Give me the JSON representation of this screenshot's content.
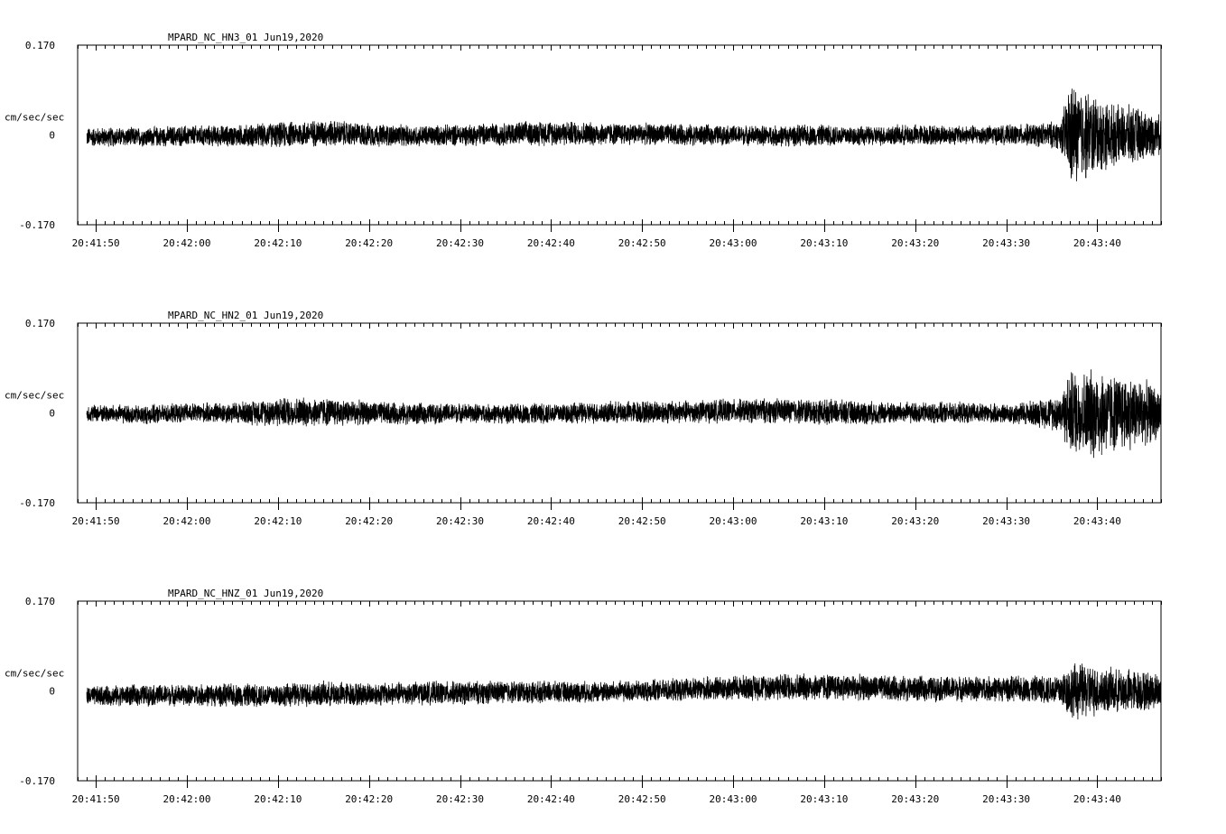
{
  "chart_data": [
    {
      "type": "line",
      "title": "MPARD_NC_HN3_01  Jun19,2020",
      "ylabel": "cm/sec/sec",
      "ylim": [
        -0.17,
        0.17
      ],
      "ytick_labels": [
        "0.170",
        "0",
        "-0.170"
      ],
      "x_start_time": "20:41:48",
      "x_end_time": "20:43:47",
      "xtick_labels": [
        "20:41:50",
        "20:42:00",
        "20:42:10",
        "20:42:20",
        "20:42:30",
        "20:42:40",
        "20:42:50",
        "20:43:00",
        "20:43:10",
        "20:43:20",
        "20:43:30",
        "20:43:40"
      ],
      "series": [
        {
          "x": [
            "20:41:49",
            "20:41:55",
            "20:42:00",
            "20:42:05",
            "20:42:10",
            "20:42:15",
            "20:42:20",
            "20:42:25",
            "20:42:30",
            "20:42:35",
            "20:42:40",
            "20:42:45",
            "20:42:50",
            "20:42:55",
            "20:43:00",
            "20:43:05",
            "20:43:10",
            "20:43:15",
            "20:43:20",
            "20:43:25",
            "20:43:30",
            "20:43:34",
            "20:43:36",
            "20:43:37",
            "20:43:38",
            "20:43:39",
            "20:43:40",
            "20:43:42",
            "20:43:44",
            "20:43:46",
            "20:43:47"
          ],
          "envelope": [
            0.02,
            0.02,
            0.022,
            0.022,
            0.026,
            0.028,
            0.024,
            0.022,
            0.022,
            0.024,
            0.026,
            0.024,
            0.022,
            0.022,
            0.02,
            0.022,
            0.022,
            0.02,
            0.022,
            0.02,
            0.02,
            0.025,
            0.03,
            0.11,
            0.1,
            0.09,
            0.08,
            0.06,
            0.06,
            0.045,
            0.04
          ],
          "offset": [
            -0.004,
            -0.004,
            -0.002,
            -0.002,
            0.0,
            0.004,
            0.0,
            -0.002,
            0.0,
            0.002,
            0.004,
            0.002,
            0.002,
            0.0,
            0.0,
            -0.002,
            0.0,
            -0.002,
            0.0,
            0.0,
            0.0,
            0.0,
            0.0,
            0.0,
            0.0,
            0.0,
            0.0,
            0.0,
            0.0,
            0.0,
            0.0
          ]
        }
      ]
    },
    {
      "type": "line",
      "title": "MPARD_NC_HN2_01  Jun19,2020",
      "ylabel": "cm/sec/sec",
      "ylim": [
        -0.17,
        0.17
      ],
      "ytick_labels": [
        "0.170",
        "0",
        "-0.170"
      ],
      "x_start_time": "20:41:48",
      "x_end_time": "20:43:47",
      "xtick_labels": [
        "20:41:50",
        "20:42:00",
        "20:42:10",
        "20:42:20",
        "20:42:30",
        "20:42:40",
        "20:42:50",
        "20:43:00",
        "20:43:10",
        "20:43:20",
        "20:43:30",
        "20:43:40"
      ],
      "series": [
        {
          "x": [
            "20:41:49",
            "20:41:55",
            "20:42:00",
            "20:42:05",
            "20:42:10",
            "20:42:15",
            "20:42:20",
            "20:42:25",
            "20:42:30",
            "20:42:35",
            "20:42:40",
            "20:42:45",
            "20:42:50",
            "20:42:55",
            "20:43:00",
            "20:43:05",
            "20:43:10",
            "20:43:15",
            "20:43:20",
            "20:43:25",
            "20:43:30",
            "20:43:34",
            "20:43:36",
            "20:43:37",
            "20:43:38",
            "20:43:39",
            "20:43:40",
            "20:43:42",
            "20:43:44",
            "20:43:46",
            "20:43:47"
          ],
          "envelope": [
            0.018,
            0.02,
            0.02,
            0.022,
            0.03,
            0.03,
            0.024,
            0.022,
            0.02,
            0.02,
            0.022,
            0.022,
            0.024,
            0.024,
            0.024,
            0.026,
            0.026,
            0.024,
            0.022,
            0.022,
            0.02,
            0.03,
            0.04,
            0.09,
            0.085,
            0.09,
            0.095,
            0.08,
            0.075,
            0.06,
            0.05
          ],
          "offset": [
            0.0,
            -0.004,
            0.0,
            0.0,
            0.002,
            0.002,
            0.0,
            -0.002,
            0.0,
            -0.002,
            0.0,
            0.0,
            0.002,
            0.002,
            0.004,
            0.004,
            0.002,
            0.0,
            0.0,
            0.0,
            -0.002,
            0.0,
            0.0,
            0.0,
            0.0,
            0.0,
            0.0,
            0.0,
            0.0,
            0.0,
            0.0
          ]
        }
      ]
    },
    {
      "type": "line",
      "title": "MPARD_NC_HNZ_01  Jun19,2020",
      "ylabel": "cm/sec/sec",
      "ylim": [
        -0.17,
        0.17
      ],
      "ytick_labels": [
        "0.170",
        "0",
        "-0.170"
      ],
      "x_start_time": "20:41:48",
      "x_end_time": "20:43:47",
      "xtick_labels": [
        "20:41:50",
        "20:42:00",
        "20:42:10",
        "20:42:20",
        "20:42:30",
        "20:42:40",
        "20:42:50",
        "20:43:00",
        "20:43:10",
        "20:43:20",
        "20:43:30",
        "20:43:40"
      ],
      "series": [
        {
          "x": [
            "20:41:49",
            "20:41:55",
            "20:42:00",
            "20:42:05",
            "20:42:10",
            "20:42:15",
            "20:42:20",
            "20:42:25",
            "20:42:30",
            "20:42:35",
            "20:42:40",
            "20:42:45",
            "20:42:50",
            "20:42:55",
            "20:43:00",
            "20:43:05",
            "20:43:10",
            "20:43:15",
            "20:43:20",
            "20:43:25",
            "20:43:30",
            "20:43:34",
            "20:43:36",
            "20:43:37",
            "20:43:38",
            "20:43:39",
            "20:43:40",
            "20:43:42",
            "20:43:44",
            "20:43:46",
            "20:43:47"
          ],
          "envelope": [
            0.02,
            0.022,
            0.022,
            0.024,
            0.024,
            0.026,
            0.024,
            0.024,
            0.024,
            0.024,
            0.022,
            0.022,
            0.022,
            0.024,
            0.026,
            0.028,
            0.028,
            0.026,
            0.026,
            0.026,
            0.026,
            0.028,
            0.035,
            0.055,
            0.06,
            0.055,
            0.05,
            0.045,
            0.045,
            0.04,
            0.035
          ],
          "offset": [
            -0.01,
            -0.008,
            -0.008,
            -0.008,
            -0.008,
            -0.006,
            -0.006,
            -0.004,
            -0.004,
            -0.002,
            -0.002,
            -0.002,
            0.0,
            0.002,
            0.006,
            0.008,
            0.008,
            0.006,
            0.004,
            0.004,
            0.004,
            0.004,
            0.002,
            0.0,
            0.0,
            0.0,
            0.0,
            0.0,
            0.0,
            0.0,
            0.0
          ]
        }
      ]
    }
  ]
}
